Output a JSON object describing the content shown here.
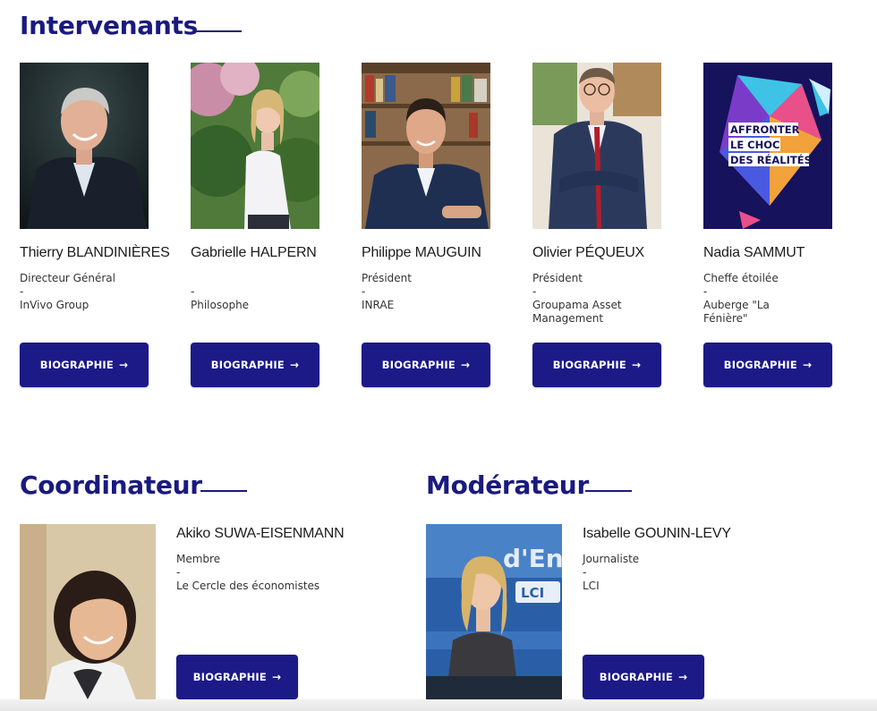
{
  "sections": {
    "intervenants": {
      "title": "Intervenants"
    },
    "coordinateur": {
      "title": "Coordinateur"
    },
    "moderateur": {
      "title": "Modérateur"
    }
  },
  "speakers": [
    {
      "name": "Thierry BLANDINIÈRES",
      "role": "Directeur Général",
      "sep": "-",
      "org": "InVivo Group",
      "button": "BIOGRAPHIE"
    },
    {
      "name": "Gabrielle HALPERN",
      "role": "",
      "sep": "-",
      "org": "Philosophe",
      "button": "BIOGRAPHIE"
    },
    {
      "name": "Philippe MAUGUIN",
      "role": "Président",
      "sep": "-",
      "org": "INRAE",
      "button": "BIOGRAPHIE"
    },
    {
      "name": "Olivier PÉQUEUX",
      "role": "Président",
      "sep": "-",
      "org": "Groupama Asset Management",
      "button": "BIOGRAPHIE"
    },
    {
      "name": "Nadia SAMMUT",
      "role": "Cheffe étoilée",
      "sep": "-",
      "org": "Auberge \"La Fénière\"",
      "button": "BIOGRAPHIE"
    }
  ],
  "poster": {
    "line1": "AFFRONTER",
    "line2": "LE CHOC",
    "line3": "DES RÉALITÉS"
  },
  "coordinator": {
    "name": "Akiko SUWA-EISENMANN",
    "role": "Membre",
    "sep": "-",
    "org": "Le Cercle des économistes",
    "button": "BIOGRAPHIE"
  },
  "moderator": {
    "name": "Isabelle GOUNIN-LEVY",
    "role": "Journaliste",
    "sep": "-",
    "org": "LCI",
    "button": "BIOGRAPHIE"
  },
  "tv_backdrop": {
    "text1": "d'En",
    "text2": "LCI"
  },
  "arrow_glyph": "→",
  "colors": {
    "accent": "#1a1a7e",
    "button": "#1c1a86"
  }
}
